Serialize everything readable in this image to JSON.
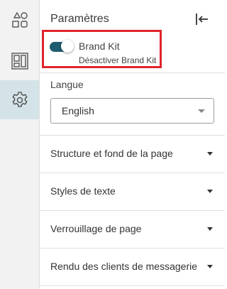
{
  "rail": {
    "items": [
      {
        "icon": "shapes-icon"
      },
      {
        "icon": "layout-icon"
      },
      {
        "icon": "gear-icon",
        "active": true
      }
    ]
  },
  "panel": {
    "title": "Paramètres",
    "collapse_icon": "collapse-left-icon",
    "brand_kit": {
      "label": "Brand Kit",
      "sublabel": "Désactiver Brand Kit",
      "enabled": true
    },
    "language": {
      "label": "Langue",
      "value": "English"
    },
    "sections": [
      {
        "label": "Structure et fond de la page"
      },
      {
        "label": "Styles de texte"
      },
      {
        "label": "Verrouillage de page"
      },
      {
        "label": "Rendu des clients de messagerie"
      }
    ]
  },
  "colors": {
    "accent": "#1f5c70",
    "highlight_border": "#e0232b",
    "active_rail": "#d3e3e8"
  }
}
